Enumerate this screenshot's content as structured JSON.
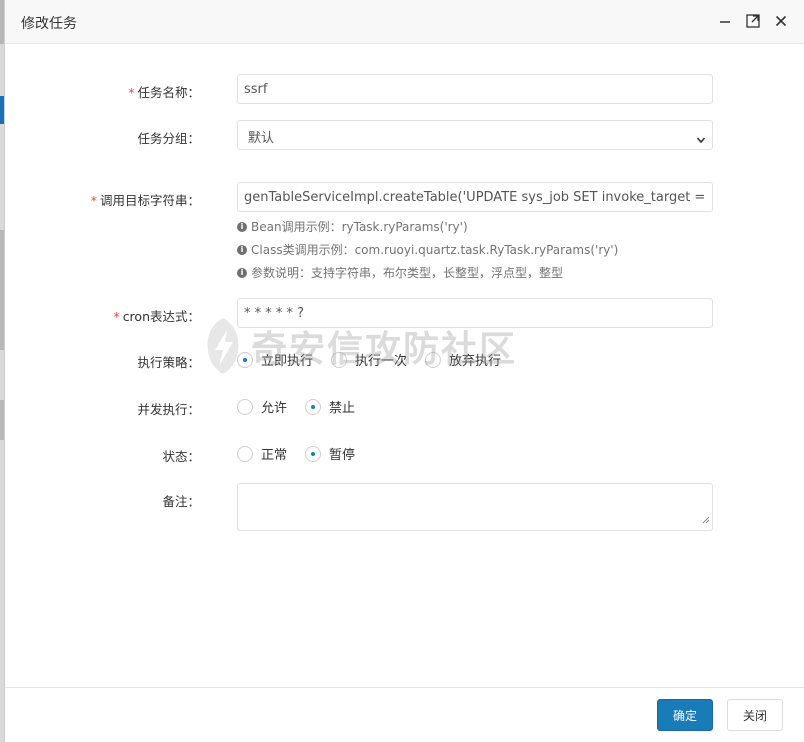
{
  "modal": {
    "title": "修改任务"
  },
  "form": {
    "task_name": {
      "label": "任务名称：",
      "required": "*",
      "value": "ssrf"
    },
    "task_group": {
      "label": "任务分组：",
      "selected": "默认"
    },
    "invoke_target": {
      "label": "调用目标字符串：",
      "required": "*",
      "value": "genTableServiceImpl.createTable('UPDATE sys_job SET invoke_target = '\"",
      "help": [
        "Bean调用示例：ryTask.ryParams('ry')",
        "Class类调用示例：com.ruoyi.quartz.task.RyTask.ryParams('ry')",
        "参数说明：支持字符串，布尔类型，长整型，浮点型，整型"
      ]
    },
    "cron": {
      "label": "cron表达式：",
      "required": "*",
      "value": "* * * * * ?"
    },
    "misfire": {
      "label": "执行策略：",
      "options": [
        "立即执行",
        "执行一次",
        "放弃执行"
      ],
      "checked_index": 0
    },
    "concurrent": {
      "label": "并发执行：",
      "options": [
        "允许",
        "禁止"
      ],
      "checked_index": 1
    },
    "status": {
      "label": "状态：",
      "options": [
        "正常",
        "暂停"
      ],
      "checked_index": 1
    },
    "remark": {
      "label": "备注：",
      "value": ""
    }
  },
  "watermark": {
    "text": "奇安信攻防社区"
  },
  "footer": {
    "confirm_label": "确定",
    "close_label": "关闭"
  },
  "colors": {
    "primary": "#1a7bb9",
    "required": "#e94a3b"
  },
  "icons": {
    "minimize": "minimize-icon",
    "maximize": "maximize-icon",
    "close": "close-icon",
    "info": "info-icon",
    "dropdown": "chevron-down-icon"
  }
}
